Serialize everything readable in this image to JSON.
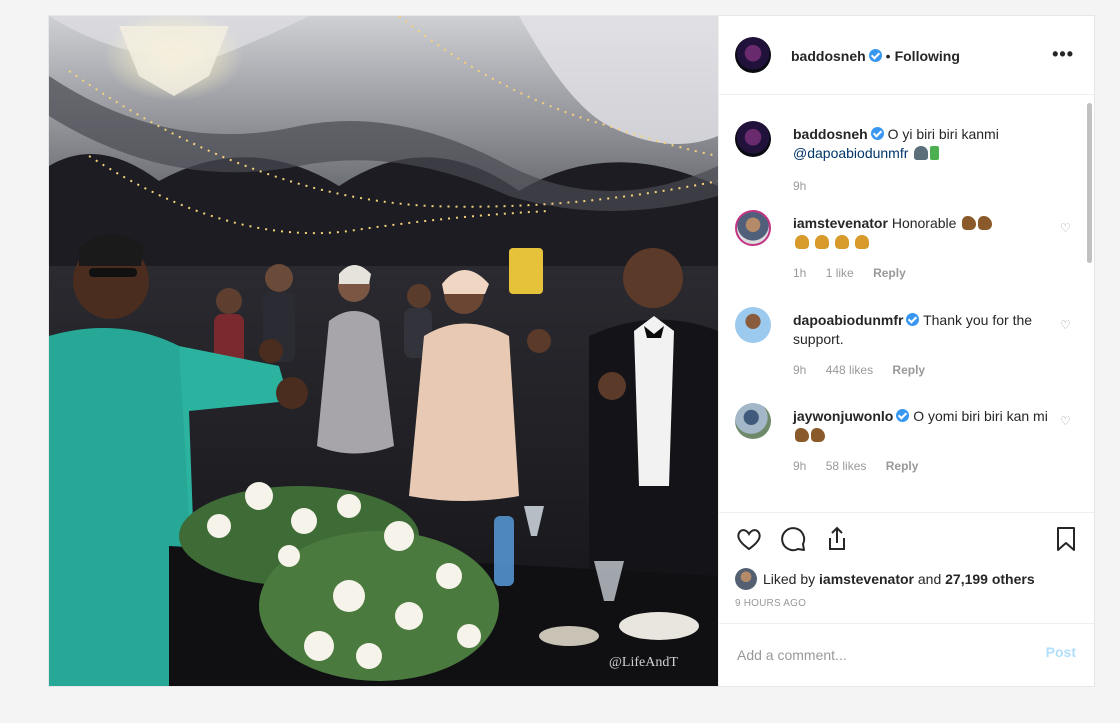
{
  "post": {
    "author": "baddosneh",
    "separator": "•",
    "follow_state": "Following",
    "more_label": "•••",
    "watermark": "@LifeAndT"
  },
  "comments": [
    {
      "user": "baddosneh",
      "verified": true,
      "text": "O yi biri biri kanmi",
      "mention": "@dapoabiodunmfr",
      "time": "9h"
    },
    {
      "user": "iamstevenator",
      "verified": false,
      "text": "Honorable",
      "time": "1h",
      "likes": "1 like",
      "reply": "Reply"
    },
    {
      "user": "dapoabiodunmfr",
      "verified": true,
      "text": "Thank you for the support.",
      "time": "9h",
      "likes": "448 likes",
      "reply": "Reply"
    },
    {
      "user": "jaywonjuwonlo",
      "verified": true,
      "text": "O yomi biri biri kan mi",
      "time": "9h",
      "likes": "58 likes",
      "reply": "Reply"
    }
  ],
  "liked_by": {
    "prefix": "Liked by",
    "user": "iamstevenator",
    "conj": "and",
    "others": "27,199 others"
  },
  "posted_ago": "9 HOURS AGO",
  "add_comment": {
    "placeholder": "Add a comment...",
    "post_label": "Post"
  },
  "icons": {
    "like": "heart-icon",
    "comment": "comment-bubble-icon",
    "share": "share-icon",
    "save": "bookmark-icon"
  },
  "colors": {
    "verified": "#3897f0",
    "post_button_disabled": "#b2dffc",
    "text": "#262626",
    "muted": "#999999"
  }
}
